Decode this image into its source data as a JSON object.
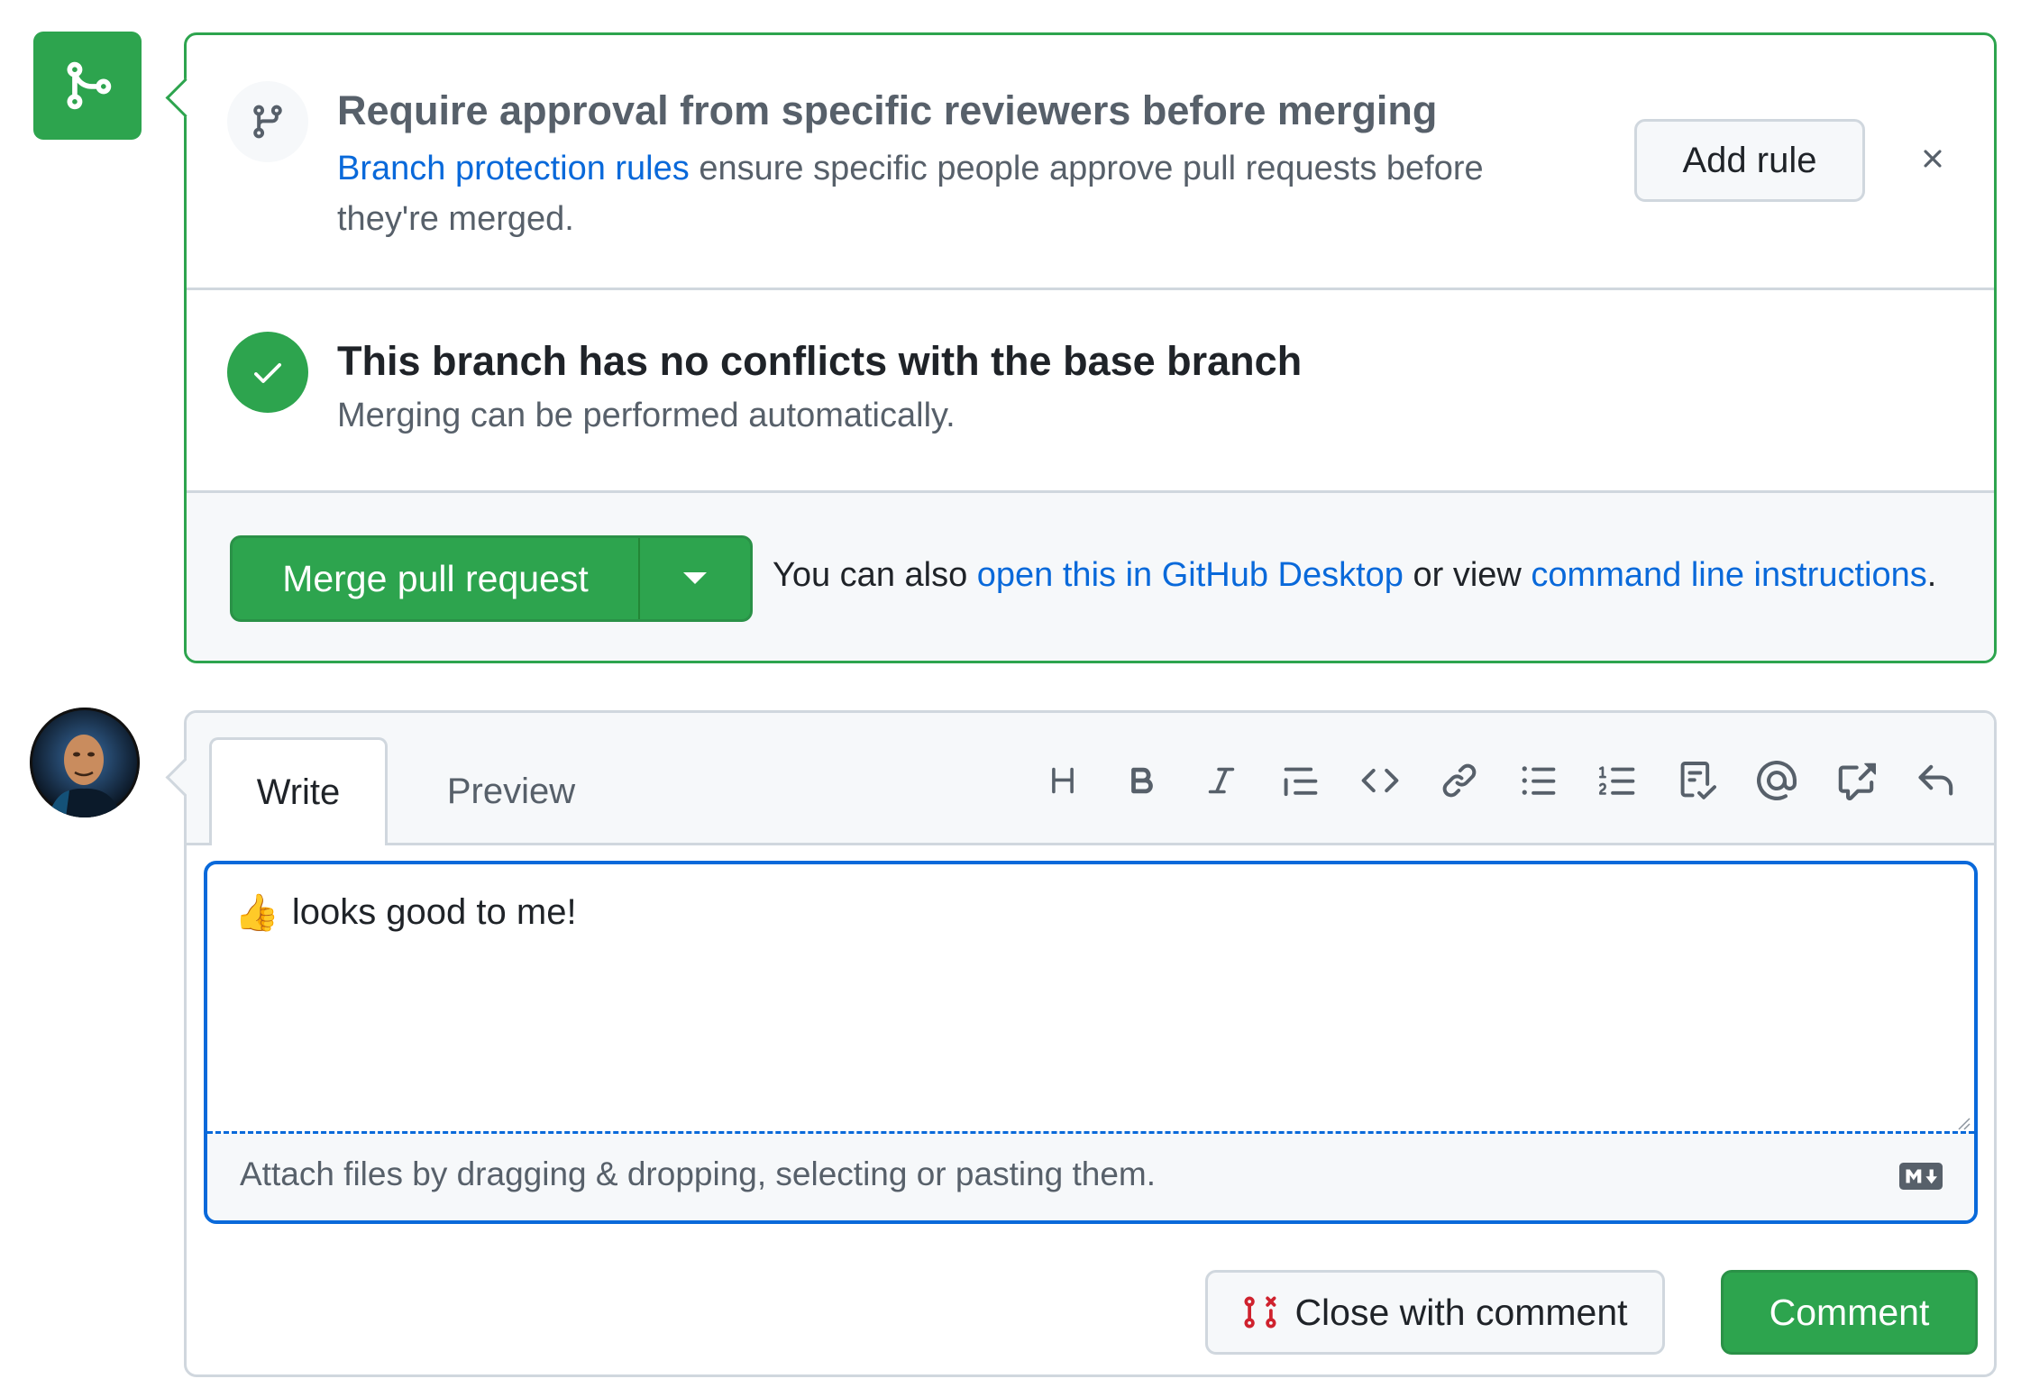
{
  "approval": {
    "title": "Require approval from specific reviewers before merging",
    "link_text": "Branch protection rules",
    "desc_rest": " ensure specific people approve pull requests before they're merged.",
    "add_rule_label": "Add rule"
  },
  "conflicts": {
    "title": "This branch has no conflicts with the base branch",
    "desc": "Merging can be performed automatically."
  },
  "merge": {
    "button_label": "Merge pull request",
    "note_prefix": "You can also ",
    "desktop_link": "open this in GitHub Desktop",
    "note_middle": " or view ",
    "cli_link": "command line instructions",
    "note_suffix": "."
  },
  "comment": {
    "tabs": [
      "Write",
      "Preview"
    ],
    "toolbar_icons": [
      "heading-icon",
      "bold-icon",
      "italic-icon",
      "quote-icon",
      "code-icon",
      "link-icon",
      "unordered-list-icon",
      "ordered-list-icon",
      "task-list-icon",
      "mention-icon",
      "cross-reference-icon",
      "reply-icon"
    ],
    "emoji": "👍",
    "text": "looks good to me!",
    "attach_text": "Attach files by dragging & dropping, selecting or pasting them.",
    "close_label": "Close with comment",
    "comment_label": "Comment"
  },
  "colors": {
    "success": "#2da44e",
    "link": "#0969da",
    "danger": "#cf222e",
    "border": "#d0d7de"
  }
}
